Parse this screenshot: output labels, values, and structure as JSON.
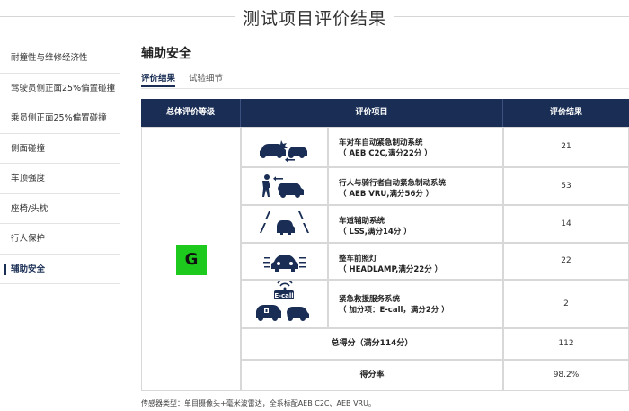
{
  "page_title": "测试项目评价结果",
  "sidebar": {
    "items": [
      {
        "label": "耐撞性与维修经济性",
        "active": false
      },
      {
        "label": "驾驶员侧正面25%偏置碰撞",
        "active": false
      },
      {
        "label": "乘员侧正面25%偏置碰撞",
        "active": false
      },
      {
        "label": "侧面碰撞",
        "active": false
      },
      {
        "label": "车顶强度",
        "active": false
      },
      {
        "label": "座椅/头枕",
        "active": false
      },
      {
        "label": "行人保护",
        "active": false
      },
      {
        "label": "辅助安全",
        "active": true
      }
    ]
  },
  "section_title": "辅助安全",
  "tabs": [
    {
      "label": "评价结果",
      "active": true
    },
    {
      "label": "试验细节",
      "active": false
    }
  ],
  "table": {
    "headers": [
      "总体评价等级",
      "评价项目",
      "评价结果"
    ],
    "overall_grade": "G",
    "grade_color": "#1cc91c",
    "header_color": "#1a2e55",
    "rows": [
      {
        "icon": "car-to-car-aeb-icon",
        "name": "车对车自动紧急制动系统",
        "sub": "（ AEB C2C,满分22分 ）",
        "result": "21"
      },
      {
        "icon": "pedestrian-cyclist-aeb-icon",
        "name": "行人与骑行者自动紧急制动系统",
        "sub": "（ AEB VRU,满分56分 ）",
        "result": "53"
      },
      {
        "icon": "lane-support-icon",
        "name": "车道辅助系统",
        "sub": "（ LSS,满分14分 ）",
        "result": "14"
      },
      {
        "icon": "headlamp-icon",
        "name": "整车前照灯",
        "sub": "（ HEADLAMP,满分22分 ）",
        "result": "22"
      },
      {
        "icon": "ecall-icon",
        "name": "紧急救援服务系统",
        "sub": "（ 加分项：E-call，满分2分 ）",
        "result": "2"
      }
    ],
    "ecall_label": "E-call",
    "total_label": "总得分（满分114分）",
    "total_value": "112",
    "rate_label": "得分率",
    "rate_value": "98.2%"
  },
  "footnote": "传感器类型：单目摄像头+毫米波雷达，全系标配AEB C2C、AEB VRU。"
}
